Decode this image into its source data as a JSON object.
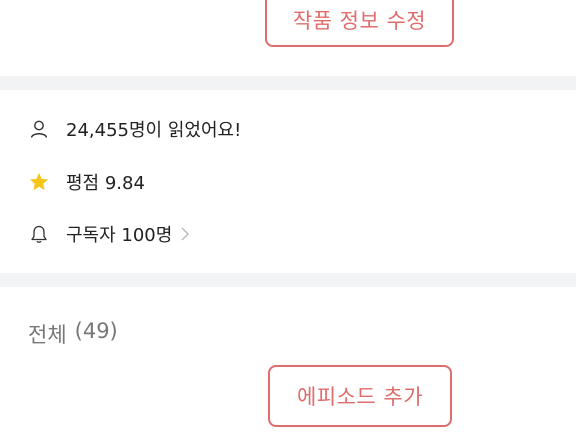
{
  "header": {
    "edit_button_label": "작품 정보 수정"
  },
  "stats": {
    "readers_text": "24,455명이 읽었어요!",
    "rating_text": "평점 9.84",
    "subscribers_text": "구독자 100명"
  },
  "episodes": {
    "label": "전체",
    "count": "(49)",
    "add_button_label": "에피소드 추가"
  },
  "colors": {
    "accent": "#e06c6c",
    "star": "#f5c518",
    "divider": "#f2f3f5"
  }
}
